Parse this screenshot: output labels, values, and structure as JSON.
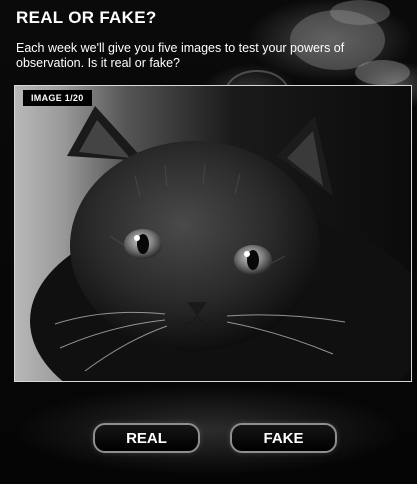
{
  "header": {
    "title": "REAL OR FAKE?",
    "subtitle": "Each week we'll give you five images to test your powers of observation.  Is it real or fake?"
  },
  "image": {
    "counter": "IMAGE 1/20",
    "subject_icon": "cat-photo"
  },
  "actions": {
    "real_label": "REAL",
    "fake_label": "FAKE"
  },
  "colors": {
    "background": "#000000",
    "text": "#ffffff",
    "button_border": "#8e8e8e"
  }
}
